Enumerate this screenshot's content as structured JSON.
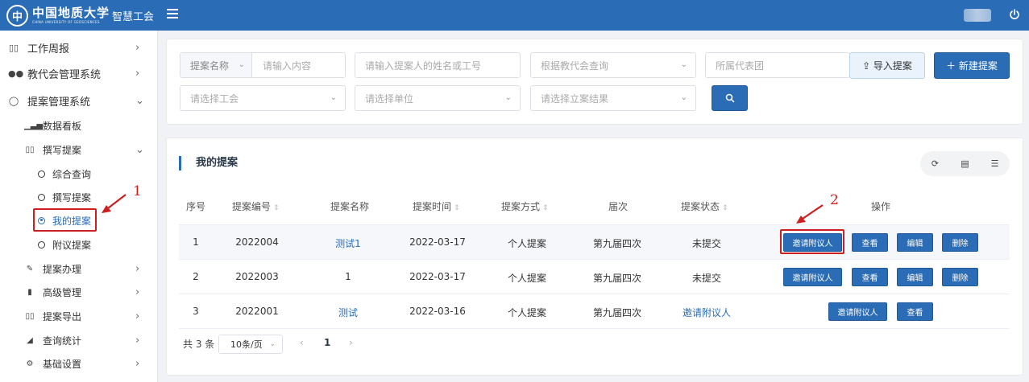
{
  "header": {
    "logo_seal": "中",
    "logo_main": "中国地质大学",
    "logo_sub": "CHINA UNIVERSITY OF GEOSCIENCES",
    "logo_suffix": "智慧工会",
    "icons": [
      "menu-icon",
      "power-icon"
    ],
    "colors": {
      "primary": "#2a6cb5"
    }
  },
  "sidebar": {
    "items": [
      {
        "label": "工作周报",
        "icon": "book-icon",
        "glyph": "▯▯"
      },
      {
        "label": "教代会管理系统",
        "icon": "people-icon",
        "glyph": "👥"
      },
      {
        "label": "提案管理系统",
        "icon": "bulb-icon",
        "glyph": "💡"
      }
    ],
    "proposal_sub": [
      {
        "label": "数据看板",
        "icon": "bar-chart-icon",
        "glyph": "▁▃▅"
      },
      {
        "label": "撰写提案",
        "icon": "book-icon",
        "glyph": "▯▯"
      }
    ],
    "write_leaves": [
      {
        "label": "综合查询"
      },
      {
        "label": "撰写提案"
      },
      {
        "label": "我的提案"
      },
      {
        "label": "附议提案"
      }
    ],
    "more_sub": [
      {
        "label": "提案办理",
        "icon": "edit-icon",
        "glyph": "✎"
      },
      {
        "label": "高级管理",
        "icon": "phone-icon",
        "glyph": "▮"
      },
      {
        "label": "提案导出",
        "icon": "book-icon",
        "glyph": "▯▯"
      },
      {
        "label": "查询统计",
        "icon": "area-chart-icon",
        "glyph": "◢"
      },
      {
        "label": "基础设置",
        "icon": "gear-icon",
        "glyph": "⚙"
      }
    ],
    "annotation_1": "1"
  },
  "search": {
    "name_prefix": "提案名称",
    "name_placeholder": "请输入内容",
    "person_placeholder": "请输入提案人的姓名或工号",
    "congress_placeholder": "根据教代会查询",
    "delegation_placeholder": "所属代表团",
    "union_placeholder": "请选择工会",
    "unit_placeholder": "请选择单位",
    "result_placeholder": "请选择立案结果",
    "import_label": "⇪ 导入提案",
    "new_label": "＋ 新建提案",
    "search_icon": "search-icon"
  },
  "table": {
    "title": "我的提案",
    "tool_icons": [
      "refresh-icon",
      "columns-icon",
      "filter-icon"
    ],
    "headers": [
      "序号",
      "提案编号",
      "提案名称",
      "提案时间",
      "提案方式",
      "届次",
      "提案状态",
      "操作"
    ],
    "rows": [
      {
        "no": "1",
        "code": "2022004",
        "name": "测试1",
        "time": "2022-03-17",
        "mode": "个人提案",
        "session": "第九届四次",
        "status": "未提交",
        "actions": [
          "邀请附议人",
          "查看",
          "编辑",
          "删除"
        ]
      },
      {
        "no": "2",
        "code": "2022003",
        "name": "1",
        "time": "2022-03-17",
        "mode": "个人提案",
        "session": "第九届四次",
        "status": "未提交",
        "actions": [
          "邀请附议人",
          "查看",
          "编辑",
          "删除"
        ]
      },
      {
        "no": "3",
        "code": "2022001",
        "name": "测试",
        "time": "2022-03-16",
        "mode": "个人提案",
        "session": "第九届四次",
        "status": "邀请附议人",
        "actions": [
          "邀请附议人",
          "查看"
        ]
      }
    ],
    "annotation_2": "2"
  },
  "pagination": {
    "total": "共 3 条",
    "page_size": "10条/页",
    "prev": "‹",
    "current": "1",
    "next": "›"
  }
}
